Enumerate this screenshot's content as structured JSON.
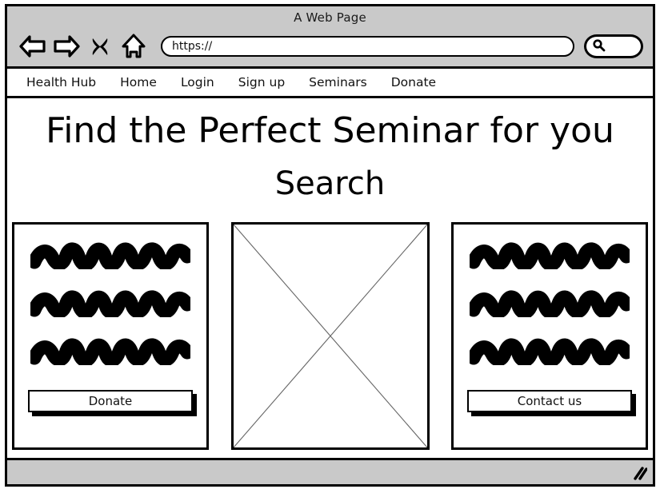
{
  "window": {
    "title": "A Web Page",
    "chrome_bg": "#c9c9c9",
    "border_color": "#000000"
  },
  "browser_toolbar": {
    "icons": [
      {
        "name": "back-arrow-icon",
        "label": "Back"
      },
      {
        "name": "forward-arrow-icon",
        "label": "Forward"
      },
      {
        "name": "close-x-icon",
        "label": "Stop"
      },
      {
        "name": "home-icon",
        "label": "Home"
      }
    ],
    "url_value": "https://",
    "url_placeholder": "https://",
    "search_icon": "search-icon",
    "search_value": "",
    "search_placeholder": ""
  },
  "site_nav": {
    "items": [
      {
        "label": "Health Hub"
      },
      {
        "label": "Home"
      },
      {
        "label": "Login"
      },
      {
        "label": "Sign up"
      },
      {
        "label": "Seminars"
      },
      {
        "label": "Donate"
      }
    ]
  },
  "main": {
    "headline": "Find the Perfect Seminar for you",
    "subhead": "Search",
    "panels": [
      {
        "type": "text-panel",
        "name": "left-panel",
        "scribble_lines": 3,
        "button": {
          "label": "Donate",
          "name": "donate-button"
        }
      },
      {
        "type": "image-placeholder",
        "name": "center-image-placeholder",
        "stroke_color": "#666666"
      },
      {
        "type": "text-panel",
        "name": "right-panel",
        "scribble_lines": 3,
        "button": {
          "label": "Contact us",
          "name": "contact-us-button"
        }
      }
    ]
  },
  "status_bar": {
    "grip_icon": "resize-grip-icon",
    "text": ""
  }
}
